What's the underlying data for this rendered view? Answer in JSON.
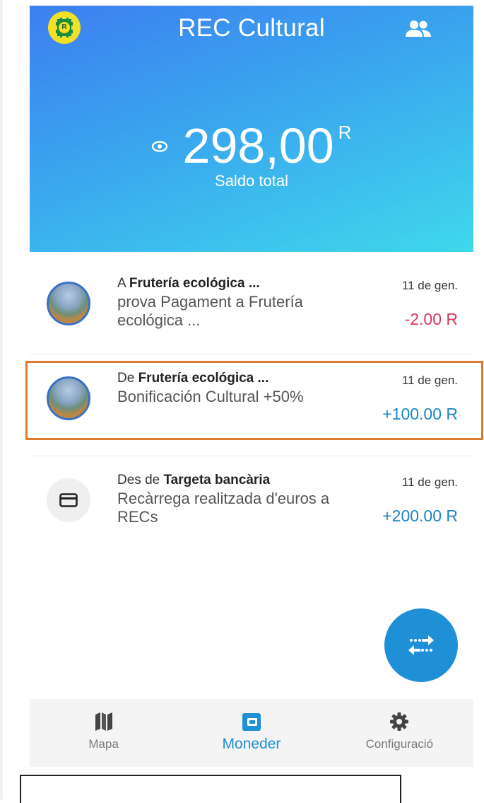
{
  "header": {
    "title": "REC Cultural",
    "balance": "298,00",
    "currency": "R",
    "balance_label": "Saldo total"
  },
  "transactions": [
    {
      "prefix": "A ",
      "counterparty": "Frutería ecológica ...",
      "description": "prova Pagament a Frutería ecológica ...",
      "date": "11 de gen.",
      "amount": "-2.00 R",
      "icon": "merchant-avatar"
    },
    {
      "prefix": "De ",
      "counterparty": "Frutería ecológica ...",
      "description": "Bonificación Cultural +50%",
      "date": "11 de gen.",
      "amount": "+100.00 R",
      "icon": "merchant-avatar"
    },
    {
      "prefix": "Des de ",
      "counterparty": "Targeta bancària",
      "description": "Recàrrega realitzada d'euros a RECs",
      "date": "11 de gen.",
      "amount": "+200.00 R",
      "icon": "credit-card-icon"
    }
  ],
  "nav": {
    "items": [
      {
        "label": "Mapa",
        "icon": "map-icon"
      },
      {
        "label": "Moneder",
        "icon": "wallet-icon"
      },
      {
        "label": "Configuració",
        "icon": "gear-icon"
      }
    ],
    "active_index": 1
  },
  "colors": {
    "accent": "#1f8fd6",
    "negative": "#d8375b",
    "highlight": "#e07a2e"
  }
}
